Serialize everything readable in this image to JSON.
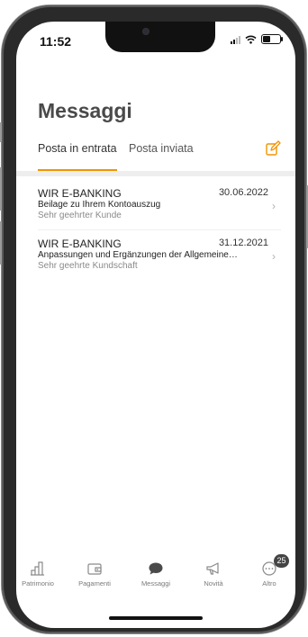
{
  "status_bar": {
    "time": "11:52"
  },
  "header": {
    "title": "Messaggi"
  },
  "tabs": [
    {
      "label": "Posta in entrata",
      "active": true
    },
    {
      "label": "Posta inviata",
      "active": false
    }
  ],
  "icons": {
    "compose": "compose-icon",
    "chevron": "chevron-right-icon"
  },
  "colors": {
    "accent": "#f29400",
    "text": "#222222",
    "muted": "#8a8a8a"
  },
  "messages": [
    {
      "sender": "WIR E-BANKING",
      "date": "30.06.2022",
      "subject": "Beilage zu Ihrem Kontoauszug",
      "preview": "Sehr geehrter Kunde"
    },
    {
      "sender": "WIR E-BANKING",
      "date": "31.12.2021",
      "subject": "Anpassungen und Ergänzungen der Allgemeine…",
      "preview": "Sehr geehrte Kundschaft"
    }
  ],
  "tabbar": [
    {
      "label": "Patrimonio",
      "icon": "bar-chart-icon"
    },
    {
      "label": "Pagamenti",
      "icon": "wallet-icon"
    },
    {
      "label": "Messaggi",
      "icon": "chat-bubble-icon"
    },
    {
      "label": "Novità",
      "icon": "megaphone-icon"
    },
    {
      "label": "Altro",
      "icon": "more-icon",
      "badge": "25"
    }
  ]
}
